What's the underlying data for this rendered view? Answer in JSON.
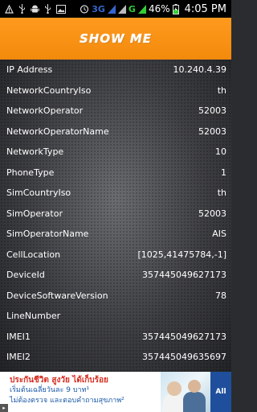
{
  "status_bar": {
    "icons_left": [
      "alert-triangle-icon",
      "usb-icon",
      "android-icon",
      "usb-icon",
      "image-icon"
    ],
    "icons_right": [
      "alarm-icon",
      "signal-icon",
      "wifi-icon",
      "signal-icon",
      "battery-charging-icon"
    ],
    "network_3g": "3G",
    "network_g": "G",
    "battery": "46%",
    "time": "4:05 PM"
  },
  "app": {
    "title": "SHOW ME",
    "accent_color": "#f7900f"
  },
  "info_rows": [
    {
      "key": "IP Address",
      "value": "10.240.4.39"
    },
    {
      "key": "NetworkCountryIso",
      "value": "th"
    },
    {
      "key": "NetworkOperator",
      "value": "52003"
    },
    {
      "key": "NetworkOperatorName",
      "value": "52003"
    },
    {
      "key": "NetworkType",
      "value": "10"
    },
    {
      "key": "PhoneType",
      "value": "1"
    },
    {
      "key": "SimCountryIso",
      "value": "th"
    },
    {
      "key": "SimOperator",
      "value": "52003"
    },
    {
      "key": "SimOperatorName",
      "value": "AIS"
    },
    {
      "key": "CellLocation",
      "value": "[1025,41475784,-1]"
    },
    {
      "key": "DeviceId",
      "value": "357445049627173"
    },
    {
      "key": "DeviceSoftwareVersion",
      "value": "78"
    },
    {
      "key": "LineNumber",
      "value": ""
    },
    {
      "key": "IMEI1",
      "value": "357445049627173"
    },
    {
      "key": "IMEI2",
      "value": "357445049635697"
    }
  ],
  "ad": {
    "line1": "ประกันชีวิต สูงวัย ได้เก็บร้อย",
    "line2": "เริ่มต้นเฉลี่ยวันละ 9 บาท¹",
    "line3": "ไม่ต้องตรวจ และตอบคำถามสุขภาพ²",
    "brand": "All"
  }
}
